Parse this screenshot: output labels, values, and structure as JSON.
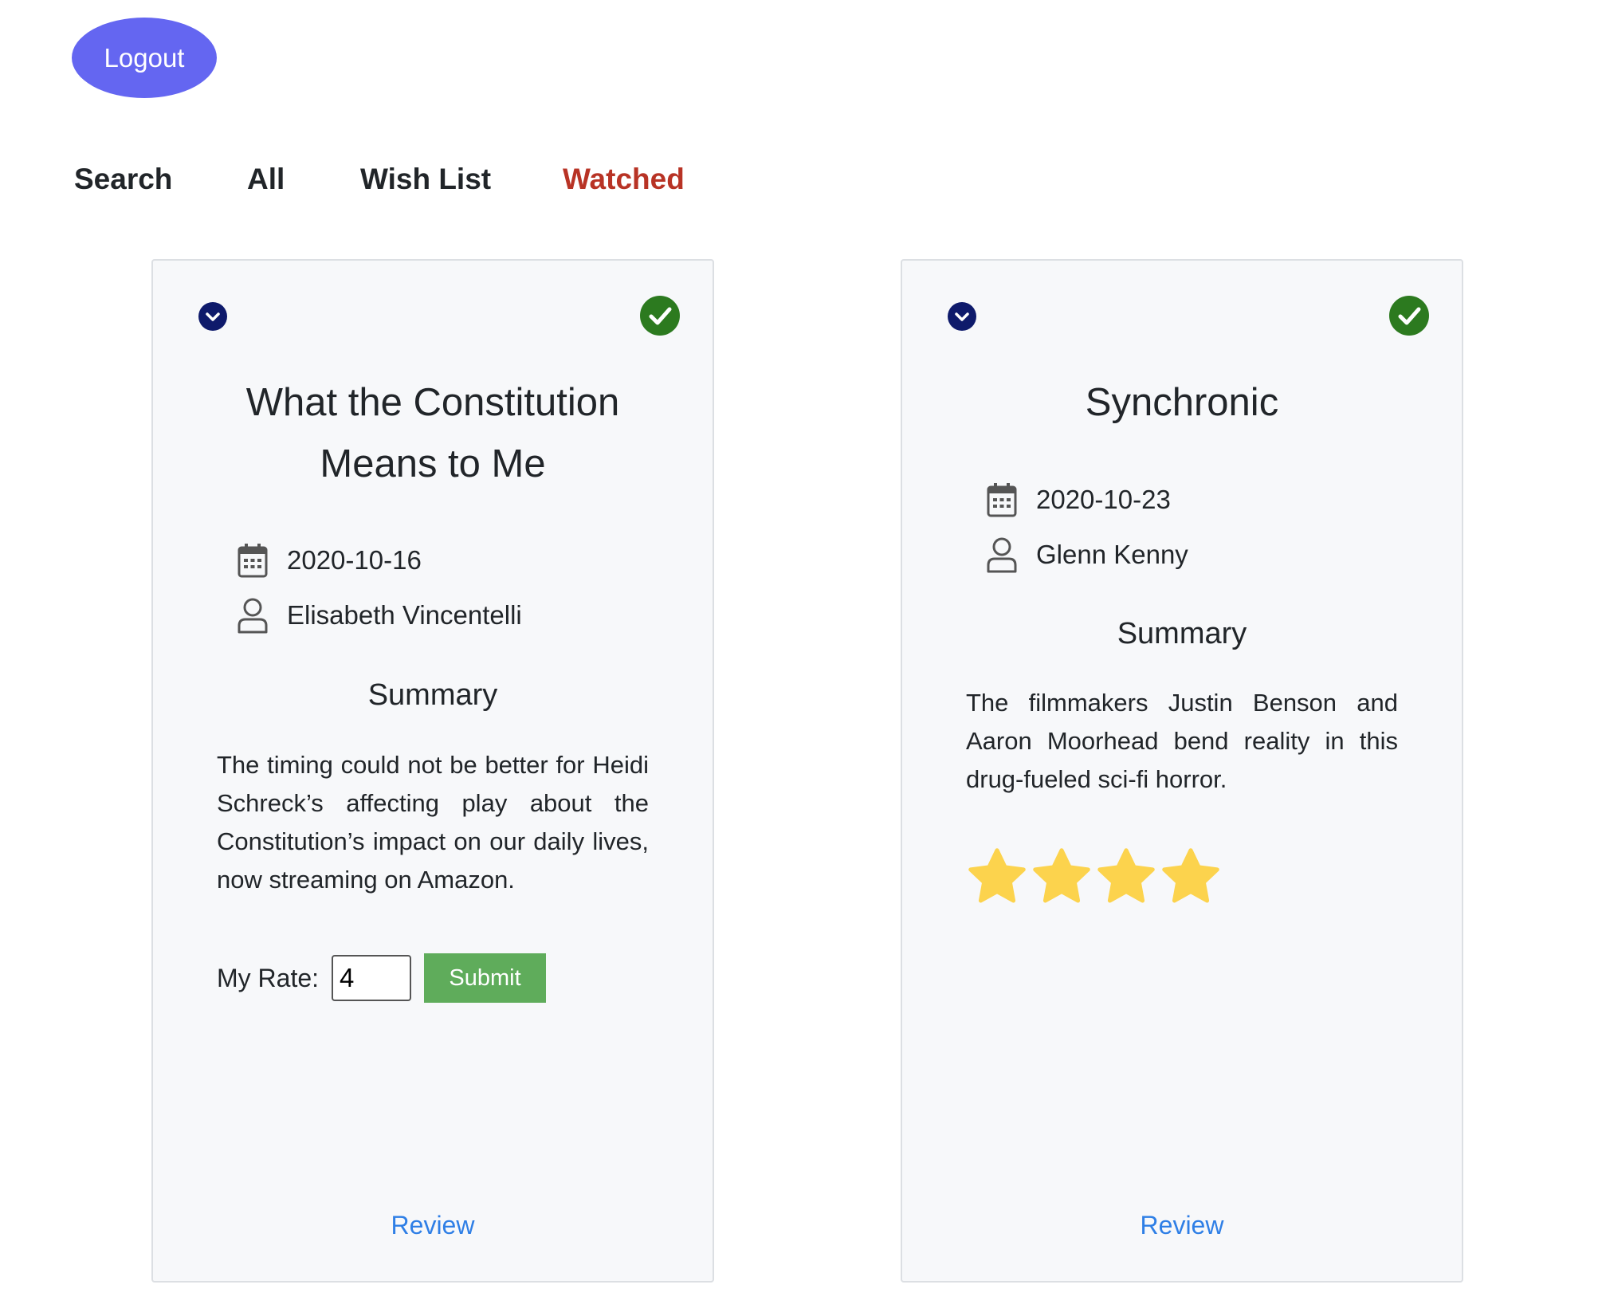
{
  "header": {
    "logout_label": "Logout"
  },
  "nav": {
    "items": [
      {
        "label": "Search",
        "active": false
      },
      {
        "label": "All",
        "active": false
      },
      {
        "label": "Wish List",
        "active": false
      },
      {
        "label": "Watched",
        "active": true
      }
    ]
  },
  "colors": {
    "accent": "#6466f1",
    "active_nav": "#b83325",
    "check_green": "#2c7a1f",
    "toggle_navy": "#0e1a6b",
    "submit_green": "#5fac5b",
    "link_blue": "#2f7fe6",
    "star_yellow": "#fcd34d"
  },
  "cards": [
    {
      "title_line1": "What the Constitution",
      "title_line2": "Means to Me",
      "date": "2020-10-16",
      "author": "Elisabeth Vincentelli",
      "summary_heading": "Summary",
      "summary": "The timing could not be better for Heidi Schreck’s affecting play about the Constitution’s impact on our daily lives, now streaming on Amazon.",
      "rate_label": "My Rate:",
      "rate_value": "4",
      "submit_label": "Submit",
      "review_label": "Review",
      "icons": [
        "chevron-down-icon",
        "check-circle-icon",
        "calendar-icon",
        "user-icon"
      ]
    },
    {
      "title_line1": "Synchronic",
      "date": "2020-10-23",
      "author": "Glenn Kenny",
      "summary_heading": "Summary",
      "summary": "The filmmakers Justin Benson and Aaron Moorhead bend reality in this drug-fueled sci-fi horror.",
      "rating_stars": 4,
      "review_label": "Review",
      "icons": [
        "chevron-down-icon",
        "check-circle-icon",
        "calendar-icon",
        "user-icon",
        "star-icon"
      ]
    }
  ]
}
